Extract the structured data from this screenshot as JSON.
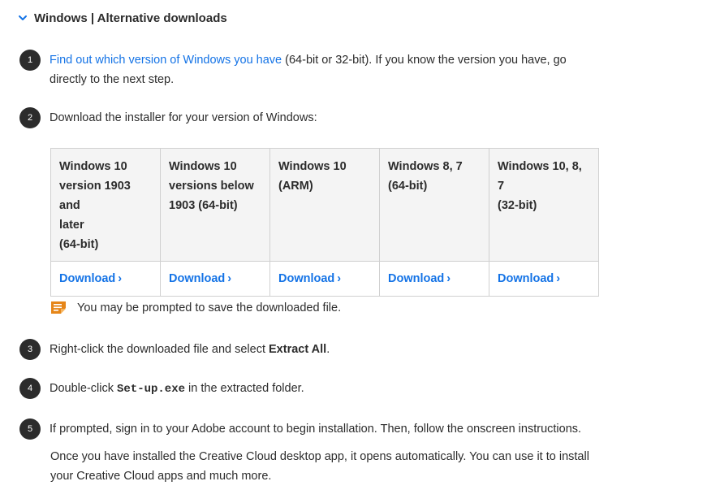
{
  "header": {
    "title": "Windows | Alternative downloads",
    "icon": "chevron-down-icon"
  },
  "accent_color": "#1473e6",
  "steps": [
    {
      "number": "1",
      "link_text": "Find out which version of Windows you have",
      "text": " (64-bit or 32-bit). If you know the version you have, go directly to the next step."
    },
    {
      "number": "2",
      "text": "Download the installer for your version of Windows:"
    },
    {
      "number": "3",
      "text_before": "Right-click the downloaded file and select ",
      "bold": "Extract All",
      "text_after": "."
    },
    {
      "number": "4",
      "text_before": "Double-click ",
      "code": "Set-up.exe",
      "text_after": " in the extracted folder."
    },
    {
      "number": "5",
      "text": "If prompted, sign in to your Adobe account to begin installation. Then, follow the onscreen instructions."
    }
  ],
  "download_table": {
    "headers": [
      [
        "Windows 10",
        "version 1903 and",
        "later",
        "(64-bit)"
      ],
      [
        "Windows 10",
        "versions below",
        "1903 (64-bit)"
      ],
      [
        "Windows 10",
        "(ARM)"
      ],
      [
        "Windows 8, 7",
        "(64-bit)"
      ],
      [
        "Windows 10, 8, 7",
        "(32-bit)"
      ]
    ],
    "download_label": "Download",
    "arrow": "›"
  },
  "note": {
    "text": "You may be prompted to save the downloaded file.",
    "icon": "note-icon",
    "icon_color": "#e68619"
  },
  "closing_text": "Once you have installed the Creative Cloud desktop app, it opens automatically. You can use it to install your Creative Cloud apps and much more."
}
